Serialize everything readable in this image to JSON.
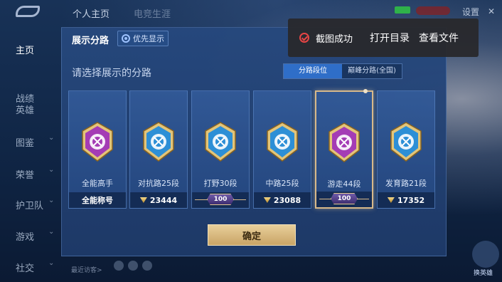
{
  "topbar": {
    "tabs": [
      "个人主页",
      "电竞生涯"
    ],
    "settings_label": "设置"
  },
  "sidebar": {
    "items": [
      {
        "label": "主页",
        "active": true,
        "chevron": false
      },
      {
        "label": "战绩",
        "active": false,
        "chevron": false
      },
      {
        "label": "英雄",
        "active": false,
        "chevron": false
      },
      {
        "label": "图鉴",
        "active": false,
        "chevron": true
      },
      {
        "label": "荣誉",
        "active": false,
        "chevron": true
      },
      {
        "label": "护卫队",
        "active": false,
        "chevron": true
      },
      {
        "label": "游戏",
        "active": false,
        "chevron": true
      },
      {
        "label": "社交",
        "active": false,
        "chevron": true
      }
    ]
  },
  "modal": {
    "title": "展示分路",
    "pref_button": "优先显示",
    "subtitle": "请选择展示的分路",
    "segments": {
      "active": "分路段位",
      "inactive": "巅峰分路(全国)"
    },
    "confirm": "确定",
    "cards": [
      {
        "label": "全能高手",
        "foot": "全能称号",
        "type": "text",
        "color": "#a43cb5",
        "selected": false
      },
      {
        "label": "对抗路25段",
        "foot": "23444",
        "type": "score",
        "color": "#2d8fd6",
        "selected": false
      },
      {
        "label": "打野30段",
        "foot": "100",
        "type": "badge",
        "color": "#2d8fd6",
        "selected": false
      },
      {
        "label": "中路25段",
        "foot": "23088",
        "type": "score",
        "color": "#2d8fd6",
        "selected": false
      },
      {
        "label": "游走44段",
        "foot": "100",
        "type": "badge",
        "color": "#a43cb5",
        "selected": true
      },
      {
        "label": "发育路21段",
        "foot": "17352",
        "type": "score",
        "color": "#2d8fd6",
        "selected": false
      }
    ]
  },
  "toast": {
    "message": "截图成功",
    "open_folder": "打开目录",
    "view_file": "查看文件"
  },
  "bottom": {
    "visitor_text": "最近访客>",
    "right_button": "换英雄"
  }
}
